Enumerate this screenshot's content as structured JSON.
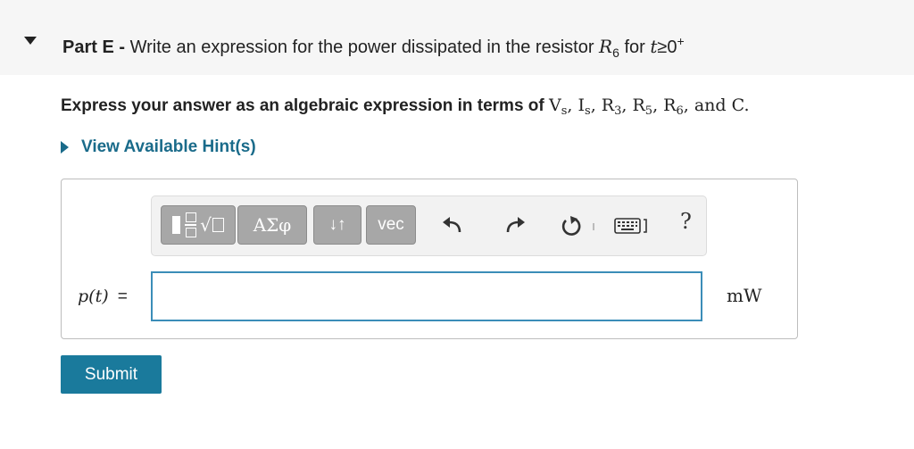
{
  "part": {
    "label": "Part E -",
    "title_text": "Write an expression for the power dissipated in the resistor",
    "symbol": "R",
    "subscript": "6",
    "for_text": "for",
    "t_symbol": "t",
    "ge": "≥",
    "zero": "0",
    "plus": "+"
  },
  "instructions": {
    "prefix": "Express your answer as an algebraic expression in terms of",
    "vars": [
      {
        "base": "V",
        "sub": "s",
        "sep": ", "
      },
      {
        "base": "I",
        "sub": "s",
        "sep": ", "
      },
      {
        "base": "R",
        "sub": "3",
        "sep": ", "
      },
      {
        "base": "R",
        "sub": "5",
        "sep": ", "
      },
      {
        "base": "R",
        "sub": "6",
        "sep": ", and "
      },
      {
        "base": "C",
        "sub": "",
        "sep": "."
      }
    ]
  },
  "hint": {
    "label": "View Available Hint(s)"
  },
  "toolbar": {
    "greek_label": "ΑΣφ",
    "arrows_label": "↓↑",
    "vec_label": "vec",
    "help_label": "?",
    "icons": [
      "templates-icon",
      "undo-icon",
      "redo-icon",
      "reset-icon",
      "keyboard-icon",
      "help-icon"
    ]
  },
  "answer": {
    "lhs_fn": "p",
    "lhs_arg": "(t)",
    "eq": "=",
    "value": "",
    "unit": "mW"
  },
  "submit": {
    "label": "Submit"
  },
  "colors": {
    "accent": "#1a7a9c",
    "input_border": "#3b8db8",
    "tool_button": "#a7a7a7"
  }
}
